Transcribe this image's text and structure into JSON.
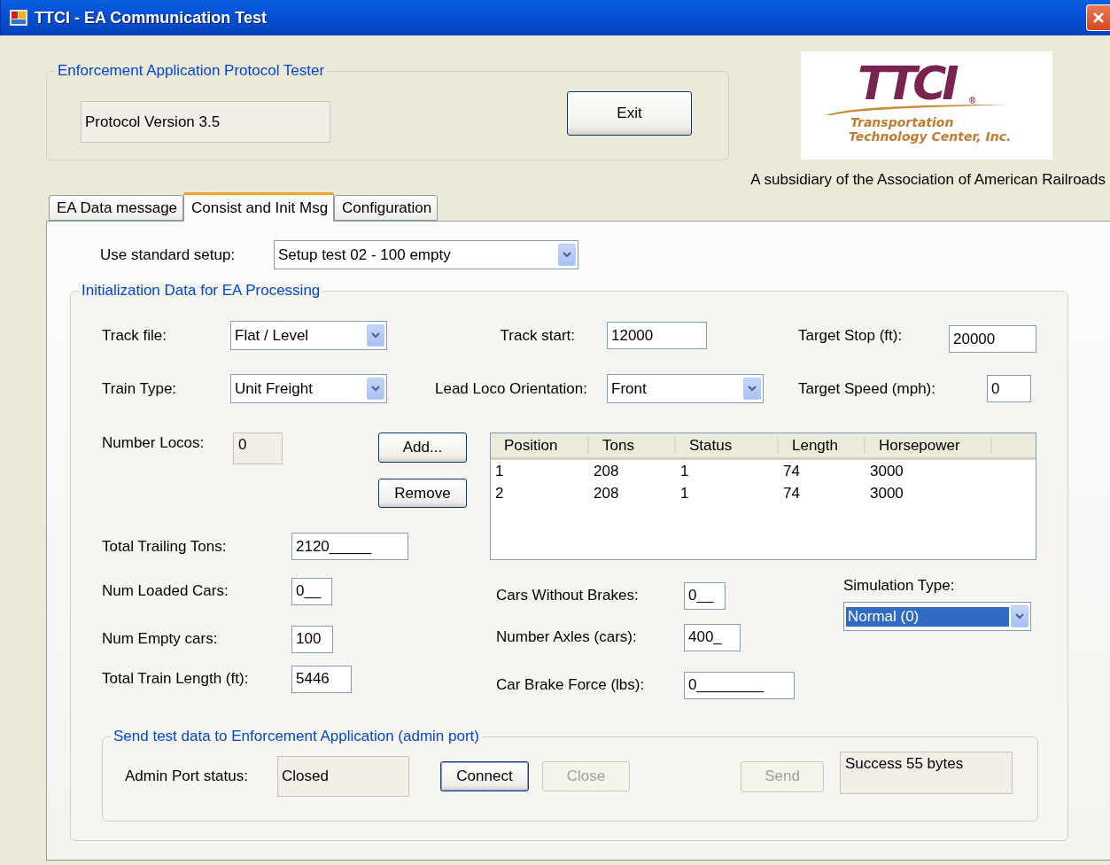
{
  "window": {
    "title": "TTCI - EA Communication Test"
  },
  "protocol_group": {
    "title": "Enforcement Application Protocol Tester",
    "version_field": {
      "kind": "text",
      "value": "Protocol Version 3.5",
      "readonly": true
    },
    "exit_button": {
      "label": "Exit",
      "disabled": false,
      "default": false
    }
  },
  "logo": {
    "mark": "TTCI",
    "registered": "®",
    "line_1": "Transportation",
    "line_2": "Technology Center, Inc."
  },
  "subsidiary": "A subsidiary of the Association of American Railroads",
  "tabs": [
    {
      "label": "EA Data message",
      "selected": false
    },
    {
      "label": "Consist and Init Msg",
      "selected": true
    },
    {
      "label": "Configuration",
      "selected": false
    }
  ],
  "standard_setup": {
    "label": "Use standard setup:",
    "kind": "combo",
    "value": "Setup test 02 - 100 empty",
    "focused": false
  },
  "init_group": {
    "title": "Initialization Data for EA Processing",
    "track_file": {
      "label": "Track file:",
      "kind": "combo",
      "value": "Flat / Level",
      "focused": false
    },
    "track_start": {
      "label": "Track start:",
      "kind": "text",
      "value": "12000",
      "readonly": false
    },
    "target_stop": {
      "label": "Target Stop (ft):",
      "kind": "text",
      "value": "20000",
      "readonly": false
    },
    "train_type": {
      "label": "Train Type:",
      "kind": "combo",
      "value": "Unit Freight",
      "focused": false
    },
    "lead_loco_orientation": {
      "label": "Lead Loco Orientation:",
      "kind": "combo",
      "value": "Front",
      "focused": false
    },
    "target_speed": {
      "label": "Target Speed (mph):",
      "kind": "text",
      "value": "0",
      "readonly": false
    },
    "number_locos": {
      "label": "Number Locos:",
      "kind": "text",
      "value": "0",
      "readonly": true
    },
    "add_button": {
      "label": "Add...",
      "disabled": false,
      "default": false
    },
    "remove_button": {
      "label": "Remove",
      "disabled": false,
      "default": false
    },
    "locos_table": {
      "columns": [
        "Position",
        "Tons",
        "Status",
        "Length",
        "Horsepower"
      ],
      "rows": [
        [
          "1",
          "208",
          "1",
          "74",
          "3000"
        ],
        [
          "2",
          "208",
          "1",
          "74",
          "3000"
        ]
      ]
    },
    "total_trailing_tons": {
      "label": "Total Trailing Tons:",
      "kind": "text",
      "value": "2120_____",
      "readonly": false
    },
    "num_loaded_cars": {
      "label": "Num Loaded Cars:",
      "kind": "text",
      "value": "0__",
      "readonly": false
    },
    "num_empty_cars": {
      "label": "Num Empty cars:",
      "kind": "text",
      "value": "100",
      "readonly": false
    },
    "total_train_length": {
      "label": "Total Train Length (ft):",
      "kind": "text",
      "value": "5446",
      "readonly": false
    },
    "cars_without_brakes": {
      "label": "Cars Without Brakes:",
      "kind": "text",
      "value": "0__",
      "readonly": false
    },
    "number_axles": {
      "label": "Number Axles (cars):",
      "kind": "text",
      "value": "400_",
      "readonly": false
    },
    "car_brake_force": {
      "label": "Car Brake Force (lbs):",
      "kind": "text",
      "value": "0________",
      "readonly": false
    },
    "simulation_type": {
      "label": "Simulation Type:",
      "kind": "combo",
      "value": "Normal (0)",
      "focused": true
    }
  },
  "send_group": {
    "title": "Send test data to Enforcement Application (admin port)",
    "admin_port_status": {
      "label": "Admin Port status:",
      "kind": "text",
      "value": "Closed",
      "readonly": true
    },
    "connect_button": {
      "label": "Connect",
      "disabled": false,
      "default": true
    },
    "close_button": {
      "label": "Close",
      "disabled": true,
      "default": false
    },
    "send_button": {
      "label": "Send",
      "disabled": true,
      "default": false
    },
    "result_field": {
      "kind": "text",
      "value": "Success 55 bytes",
      "readonly": true
    }
  }
}
